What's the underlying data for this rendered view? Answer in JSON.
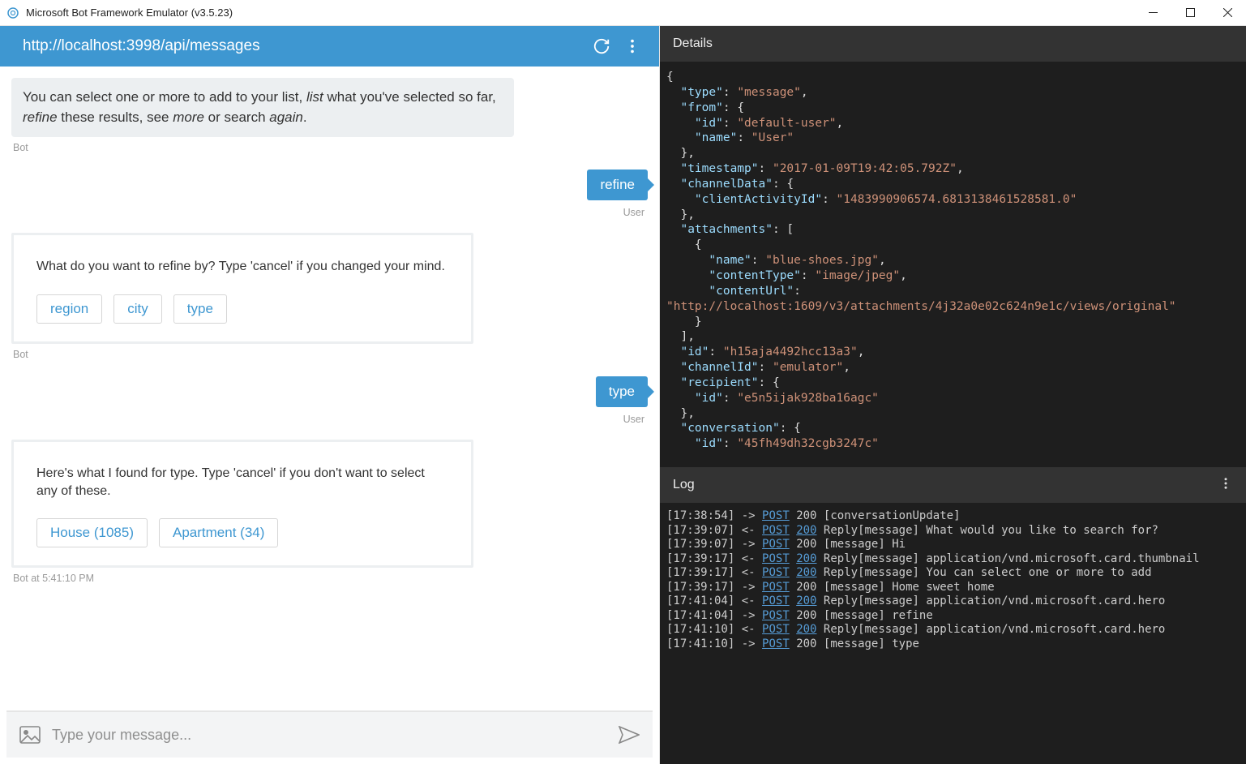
{
  "window": {
    "title": "Microsoft Bot Framework Emulator (v3.5.23)"
  },
  "addressbar": {
    "url": "http://localhost:3998/api/messages"
  },
  "labels": {
    "bot": "Bot",
    "user": "User"
  },
  "msg1_pre": "You can select one or more to add to your list, ",
  "msg1_e1": "list",
  "msg1_mid1": " what you've selected so far, ",
  "msg1_e2": "refine",
  "msg1_mid2": " these results, see ",
  "msg1_e3": "more",
  "msg1_mid3": " or search ",
  "msg1_e4": "again",
  "msg1_end": ".",
  "user1": "refine",
  "card1": {
    "text": "What do you want to refine by? Type 'cancel' if you changed your mind.",
    "btn1": "region",
    "btn2": "city",
    "btn3": "type"
  },
  "user2": "type",
  "card2": {
    "text": "Here's what I found for type. Type 'cancel' if you don't want to select any of these.",
    "btn1": "House (1085)",
    "btn2": "Apartment (34)"
  },
  "bot_ts": "Bot at 5:41:10 PM",
  "input": {
    "placeholder": "Type your message..."
  },
  "panels": {
    "details": "Details",
    "log": "Log"
  },
  "details_json": {
    "type": "message",
    "from": {
      "id": "default-user",
      "name": "User"
    },
    "timestamp": "2017-01-09T19:42:05.792Z",
    "channelData": {
      "clientActivityId": "1483990906574.6813138461528581.0"
    },
    "attachments": [
      {
        "name": "blue-shoes.jpg",
        "contentType": "image/jpeg",
        "contentUrl": "http://localhost:1609/v3/attachments/4j32a0e02c624n9e1c/views/original"
      }
    ],
    "id": "h15aja4492hcc13a3",
    "channelId": "emulator",
    "recipient": {
      "id": "e5n5ijak928ba16agc"
    },
    "conversation": {
      "id": "45fh49dh32cgb3247c"
    }
  },
  "log": [
    {
      "ts": "[17:38:54]",
      "dir": "->",
      "method": "POST",
      "code": "200",
      "text": "[conversationUpdate]",
      "codelink": false
    },
    {
      "ts": "[17:39:07]",
      "dir": "<-",
      "method": "POST",
      "code": "200",
      "text": "Reply[message] What would you like to search for?",
      "codelink": true
    },
    {
      "ts": "[17:39:07]",
      "dir": "->",
      "method": "POST",
      "code": "200",
      "text": "[message] Hi",
      "codelink": false
    },
    {
      "ts": "[17:39:17]",
      "dir": "<-",
      "method": "POST",
      "code": "200",
      "text": "Reply[message] application/vnd.microsoft.card.thumbnail",
      "codelink": true
    },
    {
      "ts": "[17:39:17]",
      "dir": "<-",
      "method": "POST",
      "code": "200",
      "text": "Reply[message] You can select one or more to add",
      "codelink": true
    },
    {
      "ts": "[17:39:17]",
      "dir": "->",
      "method": "POST",
      "code": "200",
      "text": "[message] Home sweet home",
      "codelink": false
    },
    {
      "ts": "[17:41:04]",
      "dir": "<-",
      "method": "POST",
      "code": "200",
      "text": "Reply[message] application/vnd.microsoft.card.hero",
      "codelink": true
    },
    {
      "ts": "[17:41:04]",
      "dir": "->",
      "method": "POST",
      "code": "200",
      "text": "[message] refine",
      "codelink": false
    },
    {
      "ts": "[17:41:10]",
      "dir": "<-",
      "method": "POST",
      "code": "200",
      "text": "Reply[message] application/vnd.microsoft.card.hero",
      "codelink": true
    },
    {
      "ts": "[17:41:10]",
      "dir": "->",
      "method": "POST",
      "code": "200",
      "text": "[message] type",
      "codelink": false
    }
  ]
}
